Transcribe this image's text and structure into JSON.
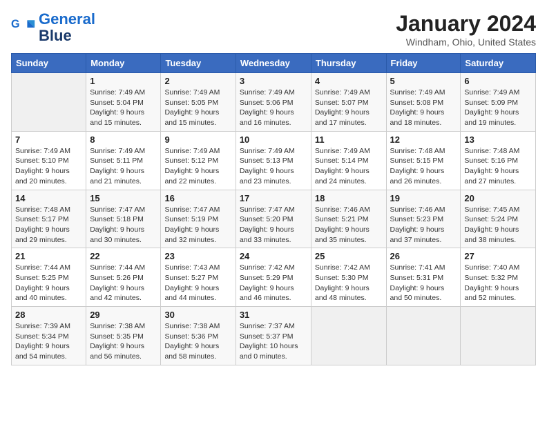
{
  "logo": {
    "line1": "General",
    "line2": "Blue"
  },
  "title": "January 2024",
  "subtitle": "Windham, Ohio, United States",
  "header_days": [
    "Sunday",
    "Monday",
    "Tuesday",
    "Wednesday",
    "Thursday",
    "Friday",
    "Saturday"
  ],
  "weeks": [
    [
      {
        "day": "",
        "info": ""
      },
      {
        "day": "1",
        "info": "Sunrise: 7:49 AM\nSunset: 5:04 PM\nDaylight: 9 hours\nand 15 minutes."
      },
      {
        "day": "2",
        "info": "Sunrise: 7:49 AM\nSunset: 5:05 PM\nDaylight: 9 hours\nand 15 minutes."
      },
      {
        "day": "3",
        "info": "Sunrise: 7:49 AM\nSunset: 5:06 PM\nDaylight: 9 hours\nand 16 minutes."
      },
      {
        "day": "4",
        "info": "Sunrise: 7:49 AM\nSunset: 5:07 PM\nDaylight: 9 hours\nand 17 minutes."
      },
      {
        "day": "5",
        "info": "Sunrise: 7:49 AM\nSunset: 5:08 PM\nDaylight: 9 hours\nand 18 minutes."
      },
      {
        "day": "6",
        "info": "Sunrise: 7:49 AM\nSunset: 5:09 PM\nDaylight: 9 hours\nand 19 minutes."
      }
    ],
    [
      {
        "day": "7",
        "info": "Sunrise: 7:49 AM\nSunset: 5:10 PM\nDaylight: 9 hours\nand 20 minutes."
      },
      {
        "day": "8",
        "info": "Sunrise: 7:49 AM\nSunset: 5:11 PM\nDaylight: 9 hours\nand 21 minutes."
      },
      {
        "day": "9",
        "info": "Sunrise: 7:49 AM\nSunset: 5:12 PM\nDaylight: 9 hours\nand 22 minutes."
      },
      {
        "day": "10",
        "info": "Sunrise: 7:49 AM\nSunset: 5:13 PM\nDaylight: 9 hours\nand 23 minutes."
      },
      {
        "day": "11",
        "info": "Sunrise: 7:49 AM\nSunset: 5:14 PM\nDaylight: 9 hours\nand 24 minutes."
      },
      {
        "day": "12",
        "info": "Sunrise: 7:48 AM\nSunset: 5:15 PM\nDaylight: 9 hours\nand 26 minutes."
      },
      {
        "day": "13",
        "info": "Sunrise: 7:48 AM\nSunset: 5:16 PM\nDaylight: 9 hours\nand 27 minutes."
      }
    ],
    [
      {
        "day": "14",
        "info": "Sunrise: 7:48 AM\nSunset: 5:17 PM\nDaylight: 9 hours\nand 29 minutes."
      },
      {
        "day": "15",
        "info": "Sunrise: 7:47 AM\nSunset: 5:18 PM\nDaylight: 9 hours\nand 30 minutes."
      },
      {
        "day": "16",
        "info": "Sunrise: 7:47 AM\nSunset: 5:19 PM\nDaylight: 9 hours\nand 32 minutes."
      },
      {
        "day": "17",
        "info": "Sunrise: 7:47 AM\nSunset: 5:20 PM\nDaylight: 9 hours\nand 33 minutes."
      },
      {
        "day": "18",
        "info": "Sunrise: 7:46 AM\nSunset: 5:21 PM\nDaylight: 9 hours\nand 35 minutes."
      },
      {
        "day": "19",
        "info": "Sunrise: 7:46 AM\nSunset: 5:23 PM\nDaylight: 9 hours\nand 37 minutes."
      },
      {
        "day": "20",
        "info": "Sunrise: 7:45 AM\nSunset: 5:24 PM\nDaylight: 9 hours\nand 38 minutes."
      }
    ],
    [
      {
        "day": "21",
        "info": "Sunrise: 7:44 AM\nSunset: 5:25 PM\nDaylight: 9 hours\nand 40 minutes."
      },
      {
        "day": "22",
        "info": "Sunrise: 7:44 AM\nSunset: 5:26 PM\nDaylight: 9 hours\nand 42 minutes."
      },
      {
        "day": "23",
        "info": "Sunrise: 7:43 AM\nSunset: 5:27 PM\nDaylight: 9 hours\nand 44 minutes."
      },
      {
        "day": "24",
        "info": "Sunrise: 7:42 AM\nSunset: 5:29 PM\nDaylight: 9 hours\nand 46 minutes."
      },
      {
        "day": "25",
        "info": "Sunrise: 7:42 AM\nSunset: 5:30 PM\nDaylight: 9 hours\nand 48 minutes."
      },
      {
        "day": "26",
        "info": "Sunrise: 7:41 AM\nSunset: 5:31 PM\nDaylight: 9 hours\nand 50 minutes."
      },
      {
        "day": "27",
        "info": "Sunrise: 7:40 AM\nSunset: 5:32 PM\nDaylight: 9 hours\nand 52 minutes."
      }
    ],
    [
      {
        "day": "28",
        "info": "Sunrise: 7:39 AM\nSunset: 5:34 PM\nDaylight: 9 hours\nand 54 minutes."
      },
      {
        "day": "29",
        "info": "Sunrise: 7:38 AM\nSunset: 5:35 PM\nDaylight: 9 hours\nand 56 minutes."
      },
      {
        "day": "30",
        "info": "Sunrise: 7:38 AM\nSunset: 5:36 PM\nDaylight: 9 hours\nand 58 minutes."
      },
      {
        "day": "31",
        "info": "Sunrise: 7:37 AM\nSunset: 5:37 PM\nDaylight: 10 hours\nand 0 minutes."
      },
      {
        "day": "",
        "info": ""
      },
      {
        "day": "",
        "info": ""
      },
      {
        "day": "",
        "info": ""
      }
    ]
  ]
}
